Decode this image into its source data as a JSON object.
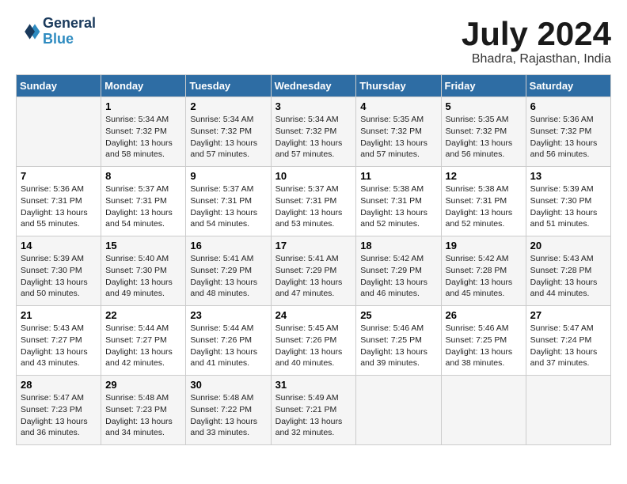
{
  "header": {
    "logo_line1": "General",
    "logo_line2": "Blue",
    "month_title": "July 2024",
    "subtitle": "Bhadra, Rajasthan, India"
  },
  "days_of_week": [
    "Sunday",
    "Monday",
    "Tuesday",
    "Wednesday",
    "Thursday",
    "Friday",
    "Saturday"
  ],
  "weeks": [
    [
      {
        "date": "",
        "text": ""
      },
      {
        "date": "1",
        "text": "Sunrise: 5:34 AM\nSunset: 7:32 PM\nDaylight: 13 hours\nand 58 minutes."
      },
      {
        "date": "2",
        "text": "Sunrise: 5:34 AM\nSunset: 7:32 PM\nDaylight: 13 hours\nand 57 minutes."
      },
      {
        "date": "3",
        "text": "Sunrise: 5:34 AM\nSunset: 7:32 PM\nDaylight: 13 hours\nand 57 minutes."
      },
      {
        "date": "4",
        "text": "Sunrise: 5:35 AM\nSunset: 7:32 PM\nDaylight: 13 hours\nand 57 minutes."
      },
      {
        "date": "5",
        "text": "Sunrise: 5:35 AM\nSunset: 7:32 PM\nDaylight: 13 hours\nand 56 minutes."
      },
      {
        "date": "6",
        "text": "Sunrise: 5:36 AM\nSunset: 7:32 PM\nDaylight: 13 hours\nand 56 minutes."
      }
    ],
    [
      {
        "date": "7",
        "text": "Sunrise: 5:36 AM\nSunset: 7:31 PM\nDaylight: 13 hours\nand 55 minutes."
      },
      {
        "date": "8",
        "text": "Sunrise: 5:37 AM\nSunset: 7:31 PM\nDaylight: 13 hours\nand 54 minutes."
      },
      {
        "date": "9",
        "text": "Sunrise: 5:37 AM\nSunset: 7:31 PM\nDaylight: 13 hours\nand 54 minutes."
      },
      {
        "date": "10",
        "text": "Sunrise: 5:37 AM\nSunset: 7:31 PM\nDaylight: 13 hours\nand 53 minutes."
      },
      {
        "date": "11",
        "text": "Sunrise: 5:38 AM\nSunset: 7:31 PM\nDaylight: 13 hours\nand 52 minutes."
      },
      {
        "date": "12",
        "text": "Sunrise: 5:38 AM\nSunset: 7:31 PM\nDaylight: 13 hours\nand 52 minutes."
      },
      {
        "date": "13",
        "text": "Sunrise: 5:39 AM\nSunset: 7:30 PM\nDaylight: 13 hours\nand 51 minutes."
      }
    ],
    [
      {
        "date": "14",
        "text": "Sunrise: 5:39 AM\nSunset: 7:30 PM\nDaylight: 13 hours\nand 50 minutes."
      },
      {
        "date": "15",
        "text": "Sunrise: 5:40 AM\nSunset: 7:30 PM\nDaylight: 13 hours\nand 49 minutes."
      },
      {
        "date": "16",
        "text": "Sunrise: 5:41 AM\nSunset: 7:29 PM\nDaylight: 13 hours\nand 48 minutes."
      },
      {
        "date": "17",
        "text": "Sunrise: 5:41 AM\nSunset: 7:29 PM\nDaylight: 13 hours\nand 47 minutes."
      },
      {
        "date": "18",
        "text": "Sunrise: 5:42 AM\nSunset: 7:29 PM\nDaylight: 13 hours\nand 46 minutes."
      },
      {
        "date": "19",
        "text": "Sunrise: 5:42 AM\nSunset: 7:28 PM\nDaylight: 13 hours\nand 45 minutes."
      },
      {
        "date": "20",
        "text": "Sunrise: 5:43 AM\nSunset: 7:28 PM\nDaylight: 13 hours\nand 44 minutes."
      }
    ],
    [
      {
        "date": "21",
        "text": "Sunrise: 5:43 AM\nSunset: 7:27 PM\nDaylight: 13 hours\nand 43 minutes."
      },
      {
        "date": "22",
        "text": "Sunrise: 5:44 AM\nSunset: 7:27 PM\nDaylight: 13 hours\nand 42 minutes."
      },
      {
        "date": "23",
        "text": "Sunrise: 5:44 AM\nSunset: 7:26 PM\nDaylight: 13 hours\nand 41 minutes."
      },
      {
        "date": "24",
        "text": "Sunrise: 5:45 AM\nSunset: 7:26 PM\nDaylight: 13 hours\nand 40 minutes."
      },
      {
        "date": "25",
        "text": "Sunrise: 5:46 AM\nSunset: 7:25 PM\nDaylight: 13 hours\nand 39 minutes."
      },
      {
        "date": "26",
        "text": "Sunrise: 5:46 AM\nSunset: 7:25 PM\nDaylight: 13 hours\nand 38 minutes."
      },
      {
        "date": "27",
        "text": "Sunrise: 5:47 AM\nSunset: 7:24 PM\nDaylight: 13 hours\nand 37 minutes."
      }
    ],
    [
      {
        "date": "28",
        "text": "Sunrise: 5:47 AM\nSunset: 7:23 PM\nDaylight: 13 hours\nand 36 minutes."
      },
      {
        "date": "29",
        "text": "Sunrise: 5:48 AM\nSunset: 7:23 PM\nDaylight: 13 hours\nand 34 minutes."
      },
      {
        "date": "30",
        "text": "Sunrise: 5:48 AM\nSunset: 7:22 PM\nDaylight: 13 hours\nand 33 minutes."
      },
      {
        "date": "31",
        "text": "Sunrise: 5:49 AM\nSunset: 7:21 PM\nDaylight: 13 hours\nand 32 minutes."
      },
      {
        "date": "",
        "text": ""
      },
      {
        "date": "",
        "text": ""
      },
      {
        "date": "",
        "text": ""
      }
    ]
  ]
}
